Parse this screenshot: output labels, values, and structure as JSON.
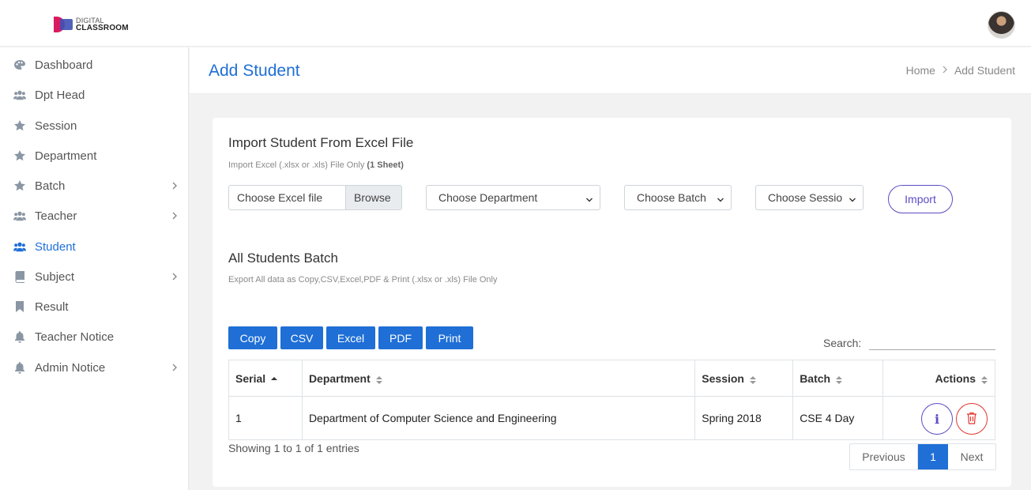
{
  "brand": {
    "line1": "DIGITAL",
    "line2": "CLASSROOM"
  },
  "sidebar": {
    "items": [
      {
        "label": "Dashboard",
        "icon": "palette-icon"
      },
      {
        "label": "Dpt Head",
        "icon": "users-icon"
      },
      {
        "label": "Session",
        "icon": "star-icon"
      },
      {
        "label": "Department",
        "icon": "star-icon"
      },
      {
        "label": "Batch",
        "icon": "star-icon",
        "has_children": true
      },
      {
        "label": "Teacher",
        "icon": "users-icon",
        "has_children": true
      },
      {
        "label": "Student",
        "icon": "users-icon",
        "active": true
      },
      {
        "label": "Subject",
        "icon": "book-icon",
        "has_children": true
      },
      {
        "label": "Result",
        "icon": "bookmark-icon"
      },
      {
        "label": "Teacher Notice",
        "icon": "bell-icon"
      },
      {
        "label": "Admin Notice",
        "icon": "bell-icon",
        "has_children": true
      }
    ]
  },
  "header": {
    "title": "Add Student",
    "breadcrumb": [
      "Home",
      "Add Student"
    ]
  },
  "import_section": {
    "title": "Import Student From Excel File",
    "subtitle": "Import Excel (.xlsx or .xls) File Only ",
    "subtitle_bold": "(1 Sheet)",
    "file_placeholder": "Choose Excel file",
    "browse_label": "Browse",
    "department_select": "Choose Department",
    "batch_select": "Choose Batch",
    "session_select": "Choose Sessio",
    "import_label": "Import"
  },
  "students_section": {
    "title": "All Students Batch",
    "subtitle": "Export All data as Copy,CSV,Excel,PDF & Print (.xlsx or .xls) File Only",
    "export_buttons": [
      "Copy",
      "CSV",
      "Excel",
      "PDF",
      "Print"
    ],
    "search_label": "Search:",
    "columns": [
      "Serial",
      "Department",
      "Session",
      "Batch",
      "Actions"
    ],
    "rows": [
      {
        "serial": "1",
        "department": "Department of Computer Science and Engineering",
        "session": "Spring 2018",
        "batch": "CSE 4 Day"
      }
    ],
    "info_label": "Showing 1 to 1 of 1 entries",
    "pagination": {
      "previous": "Previous",
      "current": "1",
      "next": "Next"
    }
  },
  "colors": {
    "primary": "#1f6fd6",
    "accent": "#5b4cc4",
    "danger": "#e3342f"
  }
}
